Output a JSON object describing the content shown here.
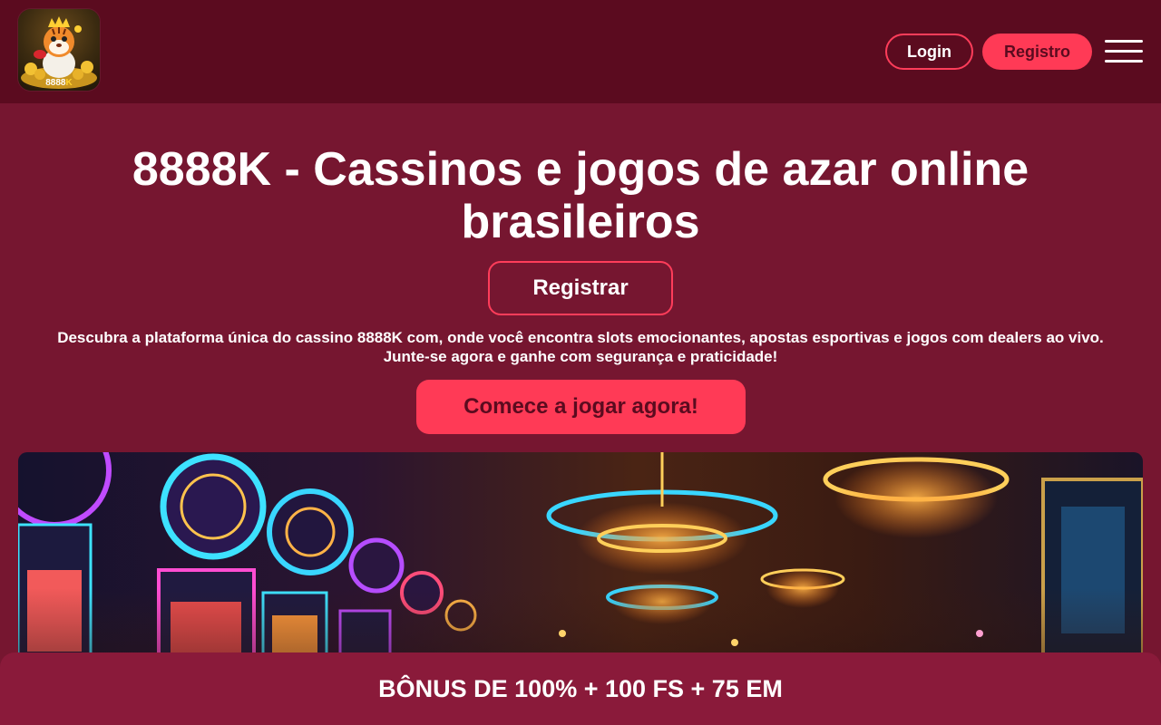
{
  "header": {
    "logo_text_main": "8888",
    "logo_text_accent": "K",
    "login_label": "Login",
    "register_label": "Registro"
  },
  "hero": {
    "title": "8888K - Cassinos e jogos de azar online brasileiros",
    "register_button": "Registrar",
    "description_line1": "Descubra a plataforma única do cassino 8888K com, onde você encontra slots emocionantes, apostas esportivas e jogos com dealers ao vivo.",
    "description_line2": "Junte-se agora e ganhe com segurança e praticidade!",
    "play_button": "Comece a jogar agora!"
  },
  "bonus": {
    "text": "BÔNUS DE 100% + 100 FS + 75 EM"
  },
  "colors": {
    "page_background": "#761630",
    "header_background": "#5b0b1f",
    "accent": "#ff3a56",
    "bonus_bar": "#8a1a3a"
  },
  "icons": {
    "menu": "hamburger-menu-icon",
    "logo": "tiger-mascot-logo"
  }
}
